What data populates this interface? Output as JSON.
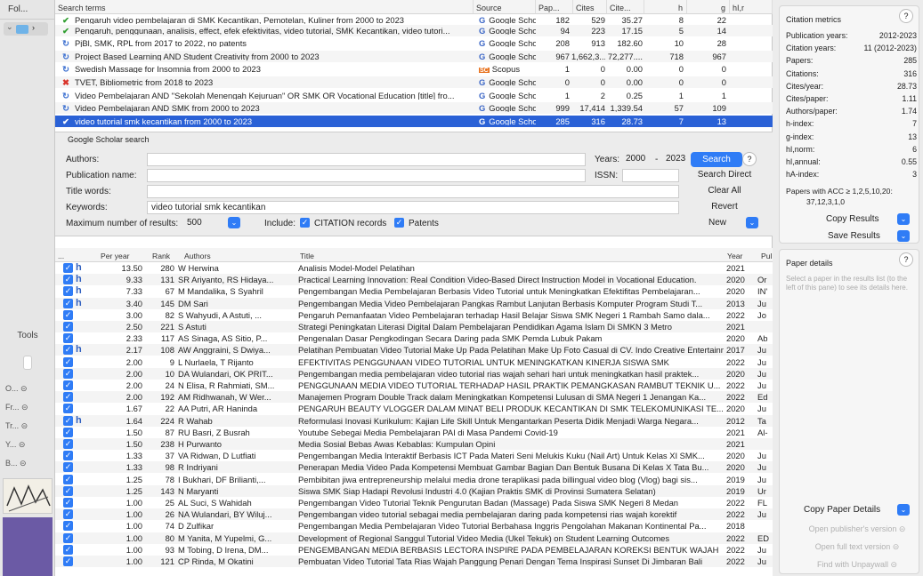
{
  "left": {
    "header": "Fol...",
    "tools": "Tools",
    "items": [
      "O... ⊝",
      "Fr... ⊝",
      "Tr... ⊝",
      "Y... ⊝",
      "B... ⊝"
    ]
  },
  "queries": {
    "columns": [
      "Search terms",
      "Source",
      "Pap...",
      "Cites",
      "Cite...",
      "h",
      "g",
      "hI,r"
    ],
    "rows": [
      {
        "icon": "✔",
        "ic": "#2e9d2e",
        "term": "Pengaruh video pembelajaran di SMK Kecantikan, Pemotelan, Kuliner from 2000 to 2023",
        "src": "Google Scho...",
        "pap": "182",
        "cites": "529",
        "cpy": "35.27",
        "h": "8",
        "g": "22"
      },
      {
        "icon": "✔",
        "ic": "#2e9d2e",
        "term": "Pengaruh, penggunaan, analisis, effect, efek efektivitas, video tutorial, SMK Kecantikan, video tutori...",
        "src": "Google Scho...",
        "pap": "94",
        "cites": "223",
        "cpy": "17.15",
        "h": "5",
        "g": "14"
      },
      {
        "icon": "↻",
        "ic": "#3b6fd0",
        "term": "PjBl, SMK, RPL from 2017 to 2022, no patents",
        "src": "Google Scho...",
        "pap": "208",
        "cites": "913",
        "cpy": "182.60",
        "h": "10",
        "g": "28"
      },
      {
        "icon": "↻",
        "ic": "#3b6fd0",
        "term": "Project Based Learning AND Student Creativity from 2000 to 2023",
        "src": "Google Scho...",
        "pap": "967",
        "cites": "1,662,3...",
        "cpy": "72,277....",
        "h": "718",
        "g": "967"
      },
      {
        "icon": "↻",
        "ic": "#3b6fd0",
        "term": "Swedish Massage for Insomnia from 2000 to 2023",
        "src": "Scopus",
        "pap": "1",
        "cites": "0",
        "cpy": "0.00",
        "h": "0",
        "g": "0"
      },
      {
        "icon": "✖",
        "ic": "#d9342b",
        "term": "TVET, Bibliometric from 2018 to 2023",
        "src": "Google Scho...",
        "pap": "0",
        "cites": "0",
        "cpy": "0.00",
        "h": "0",
        "g": "0"
      },
      {
        "icon": "↻",
        "ic": "#3b6fd0",
        "term": "Video Pembelajaran AND \"Sekolah Menengah Kejuruan\" OR SMK OR Vocational Education [title] fro...",
        "src": "Google Scho...",
        "pap": "1",
        "cites": "2",
        "cpy": "0.25",
        "h": "1",
        "g": "1"
      },
      {
        "icon": "↻",
        "ic": "#3b6fd0",
        "term": "Video Pembelajaran AND SMK from 2000 to 2023",
        "src": "Google Scho...",
        "pap": "999",
        "cites": "17,414",
        "cpy": "1,339.54",
        "h": "57",
        "g": "109"
      },
      {
        "icon": "✔",
        "ic": "#ffffff",
        "term": "video tutorial smk kecantikan from 2000 to 2023",
        "src": "Google Scho...",
        "pap": "285",
        "cites": "316",
        "cpy": "28.73",
        "h": "7",
        "g": "13"
      }
    ]
  },
  "search": {
    "title": "Google Scholar search",
    "authors_label": "Authors:",
    "pubname_label": "Publication name:",
    "title_label": "Title words:",
    "keywords_label": "Keywords:",
    "keywords": "video tutorial smk kecantikan",
    "years_label": "Years:",
    "year_from": "2000",
    "year_sep": "-",
    "year_to": "2023",
    "issn_label": "ISSN:",
    "max_label": "Maximum number of results:",
    "max_value": "500",
    "include_label": "Include:",
    "citation_records": "CITATION records",
    "patents": "Patents",
    "search_btn": "Search",
    "search_direct": "Search Direct",
    "clear_all": "Clear All",
    "revert": "Revert",
    "new": "New",
    "help": "?"
  },
  "results": {
    "columns": [
      "...",
      "Per year",
      "Rank",
      "Authors",
      "Title",
      "Year",
      "Pul"
    ],
    "rows": [
      {
        "h": true,
        "py": "13.50",
        "rank": "280",
        "au": "W Herwina",
        "ti": "Analisis Model-Model Pelatihan",
        "yr": "2021",
        "pub": ""
      },
      {
        "h": true,
        "py": "9.33",
        "rank": "131",
        "au": "SR Ariyanto, RS Hidaya...",
        "ti": "Practical Learning Innovation: Real Condition Video-Based Direct Instruction Model in Vocational Education.",
        "yr": "2020",
        "pub": "Or"
      },
      {
        "h": true,
        "py": "7.33",
        "rank": "67",
        "au": "M Mandalika, S Syahril",
        "ti": "Pengembangan Media Pembelajaran Berbasis Video Tutorial untuk Meningkatkan Efektifitas Pembelajaran...",
        "yr": "2020",
        "pub": "IN'"
      },
      {
        "h": true,
        "py": "3.40",
        "rank": "145",
        "au": "DM Sari",
        "ti": "Pengembangan Media Video Pembelajaran Pangkas Rambut Lanjutan Berbasis Komputer Program Studi T...",
        "yr": "2013",
        "pub": "Ju"
      },
      {
        "h": false,
        "py": "3.00",
        "rank": "82",
        "au": "S Wahyudi, A Astuti, ...",
        "ti": "Pengaruh Pemanfaatan Video Pembelajaran terhadap Hasil Belajar Siswa SMK Negeri 1 Rambah Samo dala...",
        "yr": "2022",
        "pub": "Jo"
      },
      {
        "h": false,
        "py": "2.50",
        "rank": "221",
        "au": "S Astuti",
        "ti": "Strategi Peningkatan Literasi Digital Dalam Pembelajaran Pendidikan Agama Islam Di SMKN 3 Metro",
        "yr": "2021",
        "pub": ""
      },
      {
        "h": false,
        "py": "2.33",
        "rank": "117",
        "au": "AS Sinaga, AS Sitio, P...",
        "ti": "Pengenalan Dasar Pengkodingan Secara Daring pada SMK Pemda Lubuk Pakam",
        "yr": "2020",
        "pub": "Ab"
      },
      {
        "h": true,
        "py": "2.17",
        "rank": "108",
        "au": "AW Anggraini, S Dwiya...",
        "ti": "Pelatihan Pembuatan Video Tutorial Make Up Pada Pelatihan Make Up Foto Casual di CV. Indo Creative Entertainment",
        "yr": "2017",
        "pub": "Ju"
      },
      {
        "h": false,
        "py": "2.00",
        "rank": "9",
        "au": "L Nurlaela, T Rijanto",
        "ti": "EFEKTIVITAS PENGGUNAAN VIDEO TUTORIAL UNTUK MENINGKATKAN KINERJA SISWA SMK",
        "yr": "2022",
        "pub": "Ju"
      },
      {
        "h": false,
        "py": "2.00",
        "rank": "10",
        "au": "DA Wulandari, OK PRIT...",
        "ti": "Pengembangan media pembelajaran video tutorial rias wajah sehari hari untuk meningkatkan hasil praktek...",
        "yr": "2020",
        "pub": "Ju"
      },
      {
        "h": false,
        "py": "2.00",
        "rank": "24",
        "au": "N Elisa, R Rahmiati, SM...",
        "ti": "PENGGUNAAN MEDIA VIDEO TUTORIAL TERHADAP HASIL PRAKTIK PEMANGKASAN RAMBUT TEKNIK U...",
        "yr": "2022",
        "pub": "Ju"
      },
      {
        "h": false,
        "py": "2.00",
        "rank": "192",
        "au": "AM Ridhwanah, W Wer...",
        "ti": "Manajemen Program Double Track dalam Meningkatkan Kompetensi Lulusan di SMA Negeri 1 Jenangan Ka...",
        "yr": "2022",
        "pub": "Ed"
      },
      {
        "h": false,
        "py": "1.67",
        "rank": "22",
        "au": "AA Putri, AR Haninda",
        "ti": "PENGARUH BEAUTY VLOGGER DALAM MINAT BELI PRODUK KECANTIKAN DI SMK TELEKOMUNIKASI TE...",
        "yr": "2020",
        "pub": "Ju"
      },
      {
        "h": true,
        "py": "1.64",
        "rank": "224",
        "au": "R Wahab",
        "ti": "Reformulasi Inovasi Kurikulum: Kajian Life Skill Untuk Mengantarkan Peserta Didik Menjadi Warga Negara...",
        "yr": "2012",
        "pub": "Ta"
      },
      {
        "h": false,
        "py": "1.50",
        "rank": "87",
        "au": "RU Basri, Z Busrah",
        "ti": "Youtube Sebegai Media Pembelajaran PAI di Masa Pandemi Covid-19",
        "yr": "2021",
        "pub": "Al-"
      },
      {
        "h": false,
        "py": "1.50",
        "rank": "238",
        "au": "H Purwanto",
        "ti": "Media Sosial Bebas Awas Kebablas: Kumpulan Opini",
        "yr": "2021",
        "pub": ""
      },
      {
        "h": false,
        "py": "1.33",
        "rank": "37",
        "au": "VA Ridwan, D Lutfiati",
        "ti": "Pengembangan Media Interaktif Berbasis ICT Pada Materi Seni Melukis Kuku (Nail Art) Untuk Kelas XI SMK...",
        "yr": "2020",
        "pub": "Ju"
      },
      {
        "h": false,
        "py": "1.33",
        "rank": "98",
        "au": "R Indriyani",
        "ti": "Penerapan Media Video Pada Kompetensi Membuat Gambar Bagian Dan Bentuk Busana Di Kelas X Tata Bu...",
        "yr": "2020",
        "pub": "Ju"
      },
      {
        "h": false,
        "py": "1.25",
        "rank": "78",
        "au": "I Bukhari, DF Brilianti,...",
        "ti": "Pembibitan jiwa entrepreneurship melalui media drone teraplikasi pada billingual video blog (Vlog) bagi sis...",
        "yr": "2019",
        "pub": "Ju"
      },
      {
        "h": false,
        "py": "1.25",
        "rank": "143",
        "au": "N Maryanti",
        "ti": "Siswa SMK Siap Hadapi Revolusi Industri 4.0 (Kajian Praktis SMK di Provinsi Sumatera Selatan)",
        "yr": "2019",
        "pub": "Ur"
      },
      {
        "h": false,
        "py": "1.00",
        "rank": "25",
        "au": "AL Suci, S Wahidah",
        "ti": "Pengembangan Video Tutorial Teknik Pengurutan Badan (Massage) Pada Siswa SMK Negeri 8 Medan",
        "yr": "2022",
        "pub": "FL"
      },
      {
        "h": false,
        "py": "1.00",
        "rank": "26",
        "au": "NA Wulandari, BY Wiluj...",
        "ti": "Pengembangan video tutorial sebagai media pembelajaran daring pada kompetensi rias wajah korektif",
        "yr": "2022",
        "pub": "Ju"
      },
      {
        "h": false,
        "py": "1.00",
        "rank": "74",
        "au": "D Zulfikar",
        "ti": "Pengembangan Media Pembelajaran Video Tutorial Berbahasa Inggris Pengolahan Makanan Kontinental Pa...",
        "yr": "2018",
        "pub": ""
      },
      {
        "h": false,
        "py": "1.00",
        "rank": "80",
        "au": "M Yanita, M Yupelmi, G...",
        "ti": "Development of Regional Sanggul Tutorial Video Media (Ukel Tekuk) on Student Learning Outcomes",
        "yr": "2022",
        "pub": "ED"
      },
      {
        "h": false,
        "py": "1.00",
        "rank": "93",
        "au": "M Tobing, D Irena, DM...",
        "ti": "PENGEMBANGAN MEDIA BERBASIS LECTORA INSPIRE PADA PEMBELAJARAN KOREKSI BENTUK WAJAH",
        "yr": "2022",
        "pub": "Ju"
      },
      {
        "h": false,
        "py": "1.00",
        "rank": "121",
        "au": "CP Rinda, M Okatini",
        "ti": "Pembuatan Video Tutorial Tata Rias Wajah Panggung Penari Dengan Tema Inspirasi Sunset Di Jimbaran Bali",
        "yr": "2022",
        "pub": "Ju"
      }
    ]
  },
  "metrics": {
    "title": "Citation metrics",
    "help": "?",
    "items": [
      {
        "k": "Publication years:",
        "v": "2012-2023"
      },
      {
        "k": "Citation years:",
        "v": "11 (2012-2023)"
      },
      {
        "k": "Papers:",
        "v": "285"
      },
      {
        "k": "Citations:",
        "v": "316"
      },
      {
        "k": "Cites/year:",
        "v": "28.73"
      },
      {
        "k": "Cites/paper:",
        "v": "1.11"
      },
      {
        "k": "Authors/paper:",
        "v": "1.74"
      },
      {
        "k": "h-index:",
        "v": "7"
      },
      {
        "k": "g-index:",
        "v": "13"
      },
      {
        "k": "hI,norm:",
        "v": "6"
      },
      {
        "k": "hI,annual:",
        "v": "0.55"
      },
      {
        "k": "hA-index:",
        "v": "3"
      }
    ],
    "acc_label": "Papers with ACC ≥ 1,2,5,10,20:",
    "acc_value": "37,12,3,1,0",
    "copy_results": "Copy Results",
    "save_results": "Save Results"
  },
  "details": {
    "title": "Paper details",
    "help": "?",
    "hint": "Select a paper in the results list (to the left of this pane) to see its details here.",
    "copy": "Copy Paper Details",
    "publisher": "Open publisher's version",
    "fulltext": "Open full text version",
    "unpaywall": "Find with Unpaywall"
  }
}
